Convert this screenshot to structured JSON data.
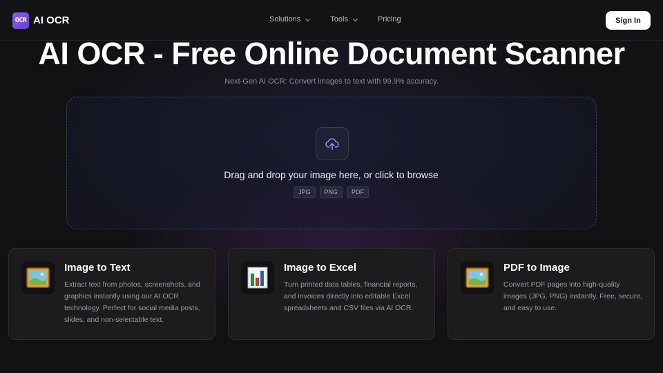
{
  "brand": {
    "logo_text": "OCR",
    "name": "AI OCR",
    "accent": "#8b5cf6"
  },
  "nav": {
    "links": [
      {
        "label": "Solutions",
        "has_dropdown": true
      },
      {
        "label": "Tools",
        "has_dropdown": true
      },
      {
        "label": "Pricing",
        "has_dropdown": false
      }
    ],
    "signin_label": "Sign In"
  },
  "hero": {
    "title": "AI OCR - Free Online Document Scanner",
    "subtitle": "Next-Gen AI OCR: Convert images to text with 99.9% accuracy."
  },
  "upload": {
    "icon": "cloud-upload-icon",
    "prompt": "Drag and drop your image here, or click to browse",
    "formats": [
      "JPG",
      "PNG",
      "PDF"
    ]
  },
  "cards": [
    {
      "icon": "framed-picture-icon",
      "title": "Image to Text",
      "description": "Extract text from photos, screenshots, and graphics instantly using our AI OCR technology. Perfect for social media posts, slides, and non-selectable text."
    },
    {
      "icon": "bar-chart-icon",
      "title": "Image to Excel",
      "description": "Turn printed data tables, financial reports, and invoices directly into editable Excel spreadsheets and CSV files via AI OCR."
    },
    {
      "icon": "framed-picture-icon",
      "title": "PDF to Image",
      "description": "Convert PDF pages into high-quality images (JPG, PNG) instantly. Free, secure, and easy to use."
    }
  ]
}
